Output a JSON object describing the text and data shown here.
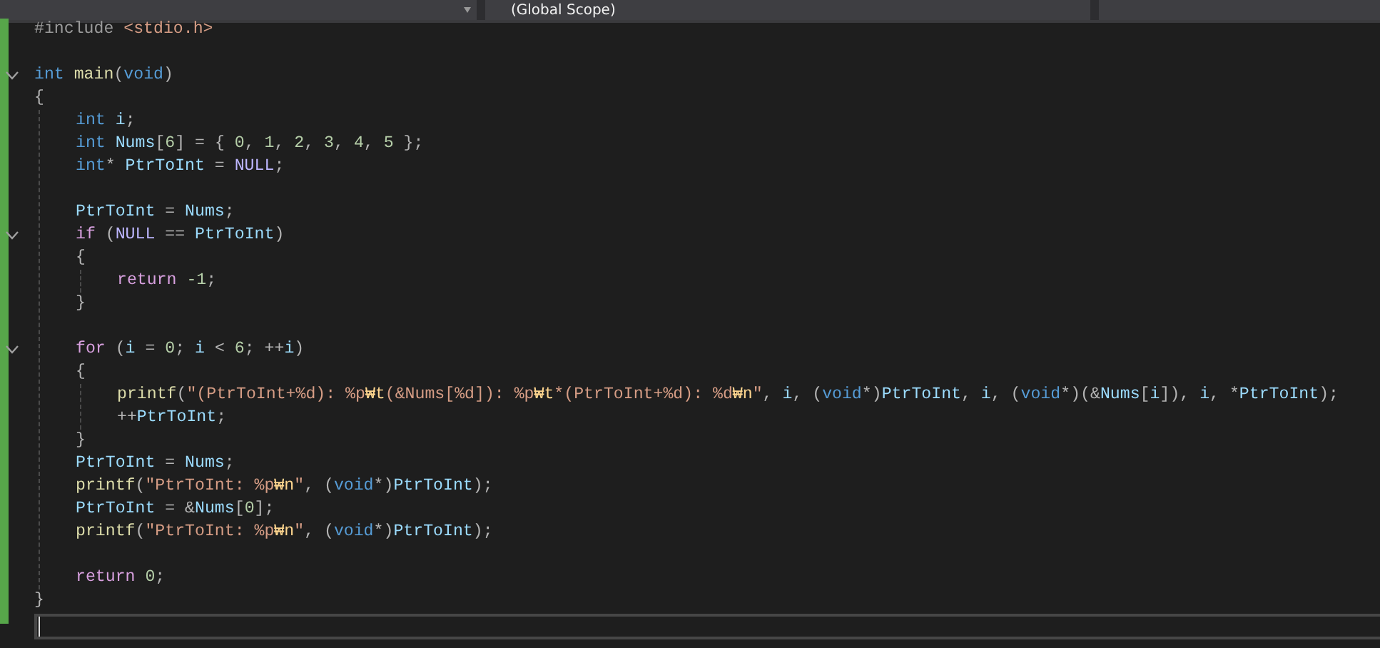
{
  "navigation_bar": {
    "dropdowns": [
      {
        "kind": "empty"
      },
      {
        "kind": "scope",
        "label": "(Global Scope)"
      },
      {
        "kind": "empty"
      }
    ]
  },
  "editor": {
    "lines": [
      {
        "kind": "code",
        "tokens": [
          {
            "t": "#include ",
            "kind": "pre"
          },
          {
            "t": "<stdio.h>",
            "kind": "inc"
          }
        ]
      },
      {
        "kind": "blank"
      },
      {
        "kind": "code",
        "expanded": true,
        "tokens": [
          {
            "t": "int ",
            "kind": "kw"
          },
          {
            "t": "main",
            "kind": "fn"
          },
          {
            "t": "(",
            "kind": "p"
          },
          {
            "t": "void",
            "kind": "kw"
          },
          {
            "t": ")",
            "kind": "p"
          }
        ]
      },
      {
        "kind": "code",
        "tokens": [
          {
            "t": "{",
            "kind": "p"
          }
        ],
        "children": [
          {
            "kind": "code",
            "tokens": [
              {
                "t": "int ",
                "kind": "kw"
              },
              {
                "t": "i",
                "kind": "var"
              },
              {
                "t": ";",
                "kind": "p"
              }
            ]
          },
          {
            "kind": "code",
            "tokens": [
              {
                "t": "int ",
                "kind": "kw"
              },
              {
                "t": "Nums",
                "kind": "var"
              },
              {
                "t": "[",
                "kind": "p"
              },
              {
                "t": "6",
                "kind": "num"
              },
              {
                "t": "] = { ",
                "kind": "p"
              },
              {
                "t": "0",
                "kind": "num"
              },
              {
                "t": ", ",
                "kind": "p"
              },
              {
                "t": "1",
                "kind": "num"
              },
              {
                "t": ", ",
                "kind": "p"
              },
              {
                "t": "2",
                "kind": "num"
              },
              {
                "t": ", ",
                "kind": "p"
              },
              {
                "t": "3",
                "kind": "num"
              },
              {
                "t": ", ",
                "kind": "p"
              },
              {
                "t": "4",
                "kind": "num"
              },
              {
                "t": ", ",
                "kind": "p"
              },
              {
                "t": "5",
                "kind": "num"
              },
              {
                "t": " };",
                "kind": "p"
              }
            ]
          },
          {
            "kind": "code",
            "tokens": [
              {
                "t": "int",
                "kind": "kw"
              },
              {
                "t": "* ",
                "kind": "p"
              },
              {
                "t": "PtrToInt",
                "kind": "var"
              },
              {
                "t": " = ",
                "kind": "p"
              },
              {
                "t": "NULL",
                "kind": "macro"
              },
              {
                "t": ";",
                "kind": "p"
              }
            ]
          },
          {
            "kind": "blank"
          },
          {
            "kind": "code",
            "tokens": [
              {
                "t": "PtrToInt",
                "kind": "var"
              },
              {
                "t": " = ",
                "kind": "p"
              },
              {
                "t": "Nums",
                "kind": "var"
              },
              {
                "t": ";",
                "kind": "p"
              }
            ]
          },
          {
            "kind": "code",
            "expanded": true,
            "tokens": [
              {
                "t": "if",
                "kind": "ctl"
              },
              {
                "t": " (",
                "kind": "p"
              },
              {
                "t": "NULL",
                "kind": "macro"
              },
              {
                "t": " == ",
                "kind": "p"
              },
              {
                "t": "PtrToInt",
                "kind": "var"
              },
              {
                "t": ")",
                "kind": "p"
              }
            ]
          },
          {
            "kind": "code",
            "tokens": [
              {
                "t": "{",
                "kind": "p"
              }
            ],
            "children": [
              {
                "kind": "code",
                "tokens": [
                  {
                    "t": "return ",
                    "kind": "ctl"
                  },
                  {
                    "t": "-1",
                    "kind": "num"
                  },
                  {
                    "t": ";",
                    "kind": "p"
                  }
                ]
              }
            ]
          },
          {
            "kind": "code",
            "tokens": [
              {
                "t": "}",
                "kind": "p"
              }
            ]
          },
          {
            "kind": "blank"
          },
          {
            "kind": "code",
            "expanded": true,
            "tokens": [
              {
                "t": "for",
                "kind": "ctl"
              },
              {
                "t": " (",
                "kind": "p"
              },
              {
                "t": "i",
                "kind": "var"
              },
              {
                "t": " = ",
                "kind": "p"
              },
              {
                "t": "0",
                "kind": "num"
              },
              {
                "t": "; ",
                "kind": "p"
              },
              {
                "t": "i",
                "kind": "var"
              },
              {
                "t": " < ",
                "kind": "p"
              },
              {
                "t": "6",
                "kind": "num"
              },
              {
                "t": "; ++",
                "kind": "p"
              },
              {
                "t": "i",
                "kind": "var"
              },
              {
                "t": ")",
                "kind": "p"
              }
            ]
          },
          {
            "kind": "code",
            "tokens": [
              {
                "t": "{",
                "kind": "p"
              }
            ],
            "children": [
              {
                "kind": "code",
                "tokens": [
                  {
                    "t": "printf",
                    "kind": "fn"
                  },
                  {
                    "t": "(",
                    "kind": "p"
                  },
                  {
                    "t": "\"(PtrToInt+%d): %p",
                    "kind": "str"
                  },
                  {
                    "t": "₩t",
                    "kind": "esc"
                  },
                  {
                    "t": "(&Nums[%d]): %p",
                    "kind": "str"
                  },
                  {
                    "t": "₩t",
                    "kind": "esc"
                  },
                  {
                    "t": "*(PtrToInt+%d): %d",
                    "kind": "str"
                  },
                  {
                    "t": "₩n",
                    "kind": "esc"
                  },
                  {
                    "t": "\"",
                    "kind": "str"
                  },
                  {
                    "t": ", ",
                    "kind": "p"
                  },
                  {
                    "t": "i",
                    "kind": "var"
                  },
                  {
                    "t": ", (",
                    "kind": "p"
                  },
                  {
                    "t": "void",
                    "kind": "kw"
                  },
                  {
                    "t": "*)",
                    "kind": "p"
                  },
                  {
                    "t": "PtrToInt",
                    "kind": "var"
                  },
                  {
                    "t": ", ",
                    "kind": "p"
                  },
                  {
                    "t": "i",
                    "kind": "var"
                  },
                  {
                    "t": ", (",
                    "kind": "p"
                  },
                  {
                    "t": "void",
                    "kind": "kw"
                  },
                  {
                    "t": "*)(&",
                    "kind": "p"
                  },
                  {
                    "t": "Nums",
                    "kind": "var"
                  },
                  {
                    "t": "[",
                    "kind": "p"
                  },
                  {
                    "t": "i",
                    "kind": "var"
                  },
                  {
                    "t": "]), ",
                    "kind": "p"
                  },
                  {
                    "t": "i",
                    "kind": "var"
                  },
                  {
                    "t": ", *",
                    "kind": "p"
                  },
                  {
                    "t": "PtrToInt",
                    "kind": "var"
                  },
                  {
                    "t": ");",
                    "kind": "p"
                  }
                ]
              },
              {
                "kind": "code",
                "tokens": [
                  {
                    "t": "++",
                    "kind": "p"
                  },
                  {
                    "t": "PtrToInt",
                    "kind": "var"
                  },
                  {
                    "t": ";",
                    "kind": "p"
                  }
                ]
              }
            ]
          },
          {
            "kind": "code",
            "tokens": [
              {
                "t": "}",
                "kind": "p"
              }
            ]
          },
          {
            "kind": "code",
            "tokens": [
              {
                "t": "PtrToInt",
                "kind": "var"
              },
              {
                "t": " = ",
                "kind": "p"
              },
              {
                "t": "Nums",
                "kind": "var"
              },
              {
                "t": ";",
                "kind": "p"
              }
            ]
          },
          {
            "kind": "code",
            "tokens": [
              {
                "t": "printf",
                "kind": "fn"
              },
              {
                "t": "(",
                "kind": "p"
              },
              {
                "t": "\"PtrToInt: %p",
                "kind": "str"
              },
              {
                "t": "₩n",
                "kind": "esc"
              },
              {
                "t": "\"",
                "kind": "str"
              },
              {
                "t": ", (",
                "kind": "p"
              },
              {
                "t": "void",
                "kind": "kw"
              },
              {
                "t": "*)",
                "kind": "p"
              },
              {
                "t": "PtrToInt",
                "kind": "var"
              },
              {
                "t": ");",
                "kind": "p"
              }
            ]
          },
          {
            "kind": "code",
            "tokens": [
              {
                "t": "PtrToInt",
                "kind": "var"
              },
              {
                "t": " = &",
                "kind": "p"
              },
              {
                "t": "Nums",
                "kind": "var"
              },
              {
                "t": "[",
                "kind": "p"
              },
              {
                "t": "0",
                "kind": "num"
              },
              {
                "t": "];",
                "kind": "p"
              }
            ]
          },
          {
            "kind": "code",
            "tokens": [
              {
                "t": "printf",
                "kind": "fn"
              },
              {
                "t": "(",
                "kind": "p"
              },
              {
                "t": "\"PtrToInt: %p",
                "kind": "str"
              },
              {
                "t": "₩n",
                "kind": "esc"
              },
              {
                "t": "\"",
                "kind": "str"
              },
              {
                "t": ", (",
                "kind": "p"
              },
              {
                "t": "void",
                "kind": "kw"
              },
              {
                "t": "*)",
                "kind": "p"
              },
              {
                "t": "PtrToInt",
                "kind": "var"
              },
              {
                "t": ");",
                "kind": "p"
              }
            ]
          },
          {
            "kind": "blank"
          },
          {
            "kind": "code",
            "tokens": [
              {
                "t": "return ",
                "kind": "ctl"
              },
              {
                "t": "0",
                "kind": "num"
              },
              {
                "t": ";",
                "kind": "p"
              }
            ]
          }
        ]
      },
      {
        "kind": "code",
        "tokens": [
          {
            "t": "}",
            "kind": "p"
          }
        ]
      },
      {
        "kind": "current"
      }
    ]
  }
}
